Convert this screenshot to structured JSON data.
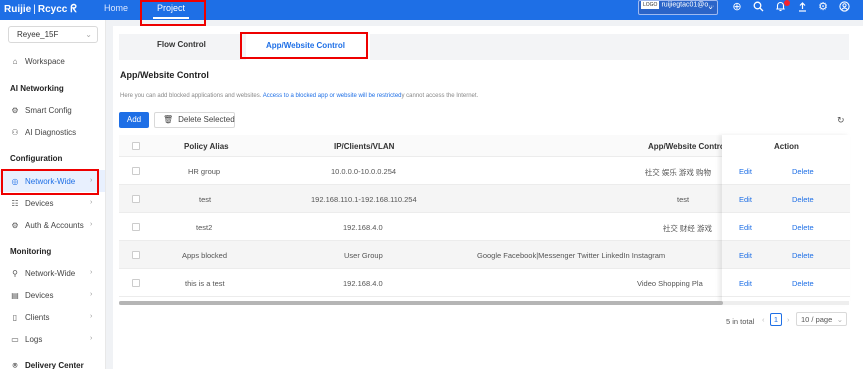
{
  "topbar": {
    "logo_brand": "Ruijie",
    "logo_product": "Rcycc",
    "nav": [
      {
        "label": "Home"
      },
      {
        "label": "Project"
      }
    ],
    "account": {
      "logo_text": "LOGO",
      "user": "ruijiegtac01@o..."
    },
    "icons": [
      "add-circle-icon",
      "search-icon",
      "bell-icon",
      "upload-icon",
      "settings-icon",
      "user-icon"
    ],
    "accent_color": "#1e6fe6"
  },
  "sidebar": {
    "site": "Reyee_15F",
    "items": [
      {
        "label": "Workspace",
        "icon": "home-icon"
      },
      {
        "label": "AI Networking",
        "type": "heading"
      },
      {
        "label": "Smart Config",
        "icon": "smart-config-icon"
      },
      {
        "label": "AI Diagnostics",
        "icon": "diagnostics-icon"
      },
      {
        "label": "Configuration",
        "type": "heading"
      },
      {
        "label": "Network-Wide",
        "icon": "globe-icon",
        "active": true
      },
      {
        "label": "Devices",
        "icon": "devices-icon"
      },
      {
        "label": "Auth & Accounts",
        "icon": "auth-icon"
      },
      {
        "label": "Monitoring",
        "type": "heading"
      },
      {
        "label": "Network-Wide",
        "icon": "network-icon"
      },
      {
        "label": "Devices",
        "icon": "devices-icon"
      },
      {
        "label": "Clients",
        "icon": "clients-icon"
      },
      {
        "label": "Logs",
        "icon": "logs-icon"
      },
      {
        "label": "Delivery Center",
        "type": "heading"
      }
    ]
  },
  "main": {
    "tabs": [
      {
        "label": "Flow Control"
      },
      {
        "label": "App/Website Control",
        "active": true
      }
    ],
    "title": "App/Website Control",
    "description_prefix": "Here you can add blocked applications and websites.",
    "description_link": "Access to a blocked app or website will be restricted",
    "description_suffix": "y cannot access the Internet.",
    "buttons": {
      "add": "Add",
      "delete_selected": "Delete Selected"
    },
    "table": {
      "columns": [
        "Policy Alias",
        "IP/Clients/VLAN",
        "App/Website Control",
        "Action"
      ],
      "rows": [
        {
          "alias": "HR group",
          "target": "10.0.0.0-10.0.0.254",
          "apps": "社交   娱乐   游戏   购物"
        },
        {
          "alias": "test",
          "target": "192.168.110.1-192.168.110.254",
          "apps": "test"
        },
        {
          "alias": "test2",
          "target": "192.168.4.0",
          "apps": "社交   财经   游戏"
        },
        {
          "alias": "Apps blocked",
          "target": "User Group",
          "apps": "Google   Facebook|Messenger   Twitter   LinkedIn   Instagram"
        },
        {
          "alias": "this is a test",
          "target": "192.168.4.0",
          "apps": "Video   Shopping   Pla"
        }
      ],
      "actions": {
        "edit": "Edit",
        "delete": "Delete"
      }
    },
    "pagination": {
      "total": "5 in total",
      "page": "1",
      "page_size": "10 / page"
    }
  }
}
